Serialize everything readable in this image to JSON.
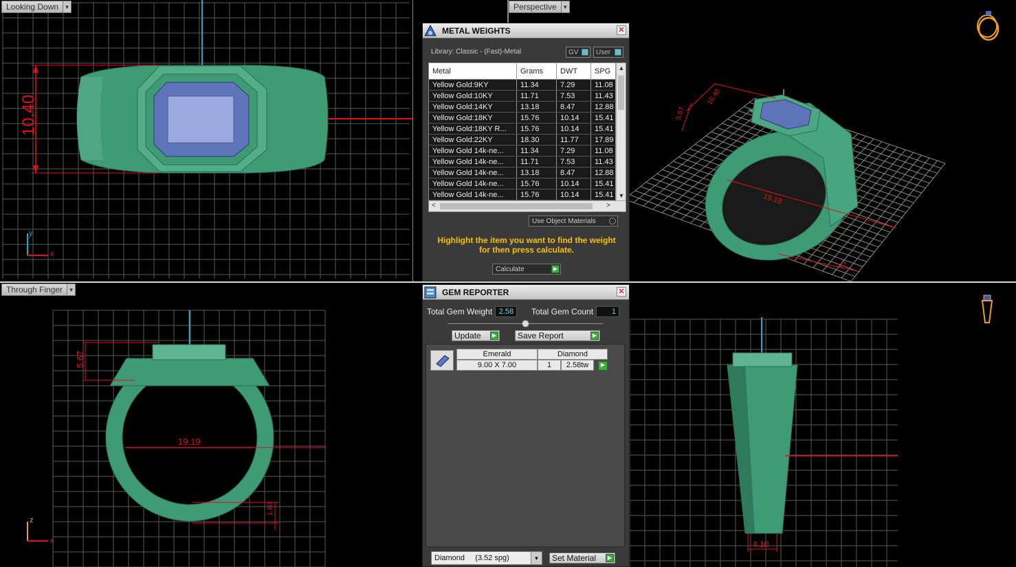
{
  "viewports": {
    "top_left": {
      "label": "Looking Down",
      "dimension": "10.40",
      "axes": [
        "y",
        "x"
      ]
    },
    "top_right": {
      "label": "Perspective",
      "dimensions": [
        "10.40",
        "5.67",
        "19.19",
        "4.1"
      ]
    },
    "bottom_left": {
      "label": "Through Finger",
      "dimensions": [
        "5.67",
        "19.19",
        "1.80"
      ],
      "axes": [
        "z",
        "x"
      ]
    },
    "bottom_right": {
      "dimension": "4.10"
    }
  },
  "metal_weights": {
    "title": "METAL WEIGHTS",
    "library": "Library: Classic - (Fast)-Metal",
    "toggle_gv": "GV",
    "toggle_user": "User",
    "columns": [
      "Metal",
      "Grams",
      "DWT",
      "SPG"
    ],
    "rows": [
      [
        "Yellow Gold:9KY",
        "11.34",
        "7.29",
        "11.08"
      ],
      [
        "Yellow Gold:10KY",
        "11.71",
        "7.53",
        "11.43"
      ],
      [
        "Yellow Gold:14KY",
        "13.18",
        "8.47",
        "12.88"
      ],
      [
        "Yellow Gold:18KY",
        "15.76",
        "10.14",
        "15.41"
      ],
      [
        "Yellow Gold:18KY R...",
        "15.76",
        "10.14",
        "15.41"
      ],
      [
        "Yellow Gold:22KY",
        "18.30",
        "11.77",
        "17.89"
      ],
      [
        "Yellow Gold 14k-ne...",
        "11.34",
        "7.29",
        "11.08"
      ],
      [
        "Yellow Gold 14k-ne...",
        "11.71",
        "7.53",
        "11.43"
      ],
      [
        "Yellow Gold 14k-ne...",
        "13.18",
        "8.47",
        "12.88"
      ],
      [
        "Yellow Gold 14k-ne...",
        "15.76",
        "10.14",
        "15.41"
      ],
      [
        "Yellow Gold 14k-ne...",
        "15.76",
        "10.14",
        "15.41"
      ]
    ],
    "use_object_materials": "Use Object Materials",
    "hint_line1": "Highlight the item you want to find the weight",
    "hint_line2": "for then press calculate.",
    "calculate": "Calculate"
  },
  "gem_reporter": {
    "title": "GEM REPORTER",
    "total_weight_label": "Total Gem Weight",
    "total_weight": "2.58",
    "total_count_label": "Total Gem Count",
    "total_count": "1",
    "update": "Update",
    "save_report": "Save Report",
    "gem": {
      "cut": "Emerald",
      "size": "9.00 X 7.00",
      "material": "Diamond",
      "count": "1",
      "weight": "2.58tw"
    },
    "material_select": "Diamond     (3.52 spg)",
    "set_material": "Set Material"
  },
  "colors": {
    "ring": "#3f9a76",
    "ring_light": "#5fb593",
    "gem": "#7f95d6",
    "dim": "#e0101a",
    "axis": "#1fa8c8",
    "hint": "#f5c100"
  }
}
